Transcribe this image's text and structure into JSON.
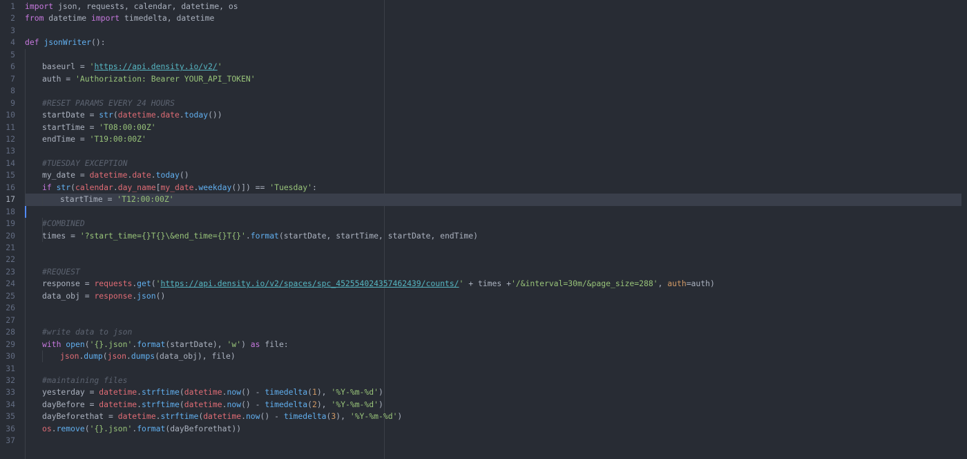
{
  "editor": {
    "active_line": 17,
    "colors": {
      "background": "#282c34",
      "keyword": "#c678dd",
      "function": "#61afef",
      "string": "#98c379",
      "number": "#d19a66",
      "module": "#e06c75",
      "comment": "#5c6370",
      "url": "#56b6c2",
      "text": "#abb2bf",
      "cursor": "#528bff"
    },
    "lines": [
      {
        "n": "1",
        "indent": 0,
        "tokens": [
          [
            "kw",
            "import"
          ],
          [
            "txt",
            " json, requests, calendar, datetime, os"
          ]
        ]
      },
      {
        "n": "2",
        "indent": 0,
        "tokens": [
          [
            "kw",
            "from"
          ],
          [
            "txt",
            " datetime "
          ],
          [
            "kw",
            "import"
          ],
          [
            "txt",
            " timedelta, datetime"
          ]
        ]
      },
      {
        "n": "3",
        "indent": 0,
        "tokens": []
      },
      {
        "n": "4",
        "indent": 0,
        "tokens": [
          [
            "kw",
            "def"
          ],
          [
            "txt",
            " "
          ],
          [
            "fn",
            "jsonWriter"
          ],
          [
            "txt",
            "():"
          ]
        ]
      },
      {
        "n": "5",
        "indent": 0,
        "tokens": []
      },
      {
        "n": "6",
        "indent": 1,
        "tokens": [
          [
            "txt",
            "baseurl = "
          ],
          [
            "str",
            "'"
          ],
          [
            "url",
            "https://api.density.io/v2/"
          ],
          [
            "str",
            "'"
          ]
        ]
      },
      {
        "n": "7",
        "indent": 1,
        "tokens": [
          [
            "txt",
            "auth = "
          ],
          [
            "str",
            "'Authorization: Bearer YOUR_API_TOKEN'"
          ]
        ]
      },
      {
        "n": "8",
        "indent": 0,
        "tokens": []
      },
      {
        "n": "9",
        "indent": 1,
        "tokens": [
          [
            "cm",
            "#RESET PARAMS EVERY 24 HOURS"
          ]
        ]
      },
      {
        "n": "10",
        "indent": 1,
        "tokens": [
          [
            "txt",
            "startDate = "
          ],
          [
            "fn",
            "str"
          ],
          [
            "txt",
            "("
          ],
          [
            "mod",
            "datetime"
          ],
          [
            "txt",
            "."
          ],
          [
            "mod",
            "date"
          ],
          [
            "txt",
            "."
          ],
          [
            "fn",
            "today"
          ],
          [
            "txt",
            "())"
          ]
        ]
      },
      {
        "n": "11",
        "indent": 1,
        "tokens": [
          [
            "txt",
            "startTime = "
          ],
          [
            "str",
            "'T08:00:00Z'"
          ]
        ]
      },
      {
        "n": "12",
        "indent": 1,
        "tokens": [
          [
            "txt",
            "endTime = "
          ],
          [
            "str",
            "'T19:00:00Z'"
          ]
        ]
      },
      {
        "n": "13",
        "indent": 0,
        "tokens": []
      },
      {
        "n": "14",
        "indent": 1,
        "tokens": [
          [
            "cm",
            "#TUESDAY EXCEPTION"
          ]
        ]
      },
      {
        "n": "15",
        "indent": 1,
        "tokens": [
          [
            "txt",
            "my_date = "
          ],
          [
            "mod",
            "datetime"
          ],
          [
            "txt",
            "."
          ],
          [
            "mod",
            "date"
          ],
          [
            "txt",
            "."
          ],
          [
            "fn",
            "today"
          ],
          [
            "txt",
            "()"
          ]
        ]
      },
      {
        "n": "16",
        "indent": 1,
        "tokens": [
          [
            "kw",
            "if"
          ],
          [
            "txt",
            " "
          ],
          [
            "fn",
            "str"
          ],
          [
            "txt",
            "("
          ],
          [
            "mod",
            "calendar"
          ],
          [
            "txt",
            "."
          ],
          [
            "mod",
            "day_name"
          ],
          [
            "txt",
            "["
          ],
          [
            "mod",
            "my_date"
          ],
          [
            "txt",
            "."
          ],
          [
            "fn",
            "weekday"
          ],
          [
            "txt",
            "()]) == "
          ],
          [
            "str",
            "'Tuesday'"
          ],
          [
            "txt",
            ":"
          ]
        ]
      },
      {
        "n": "17",
        "indent": 2,
        "tokens": [
          [
            "txt",
            "startTime = "
          ],
          [
            "str",
            "'T12:00:00Z'"
          ]
        ]
      },
      {
        "n": "18",
        "indent": 0,
        "tokens": []
      },
      {
        "n": "19",
        "indent": 1,
        "tokens": [
          [
            "cm",
            "#COMBINED"
          ]
        ]
      },
      {
        "n": "20",
        "indent": 1,
        "tokens": [
          [
            "txt",
            "times = "
          ],
          [
            "str",
            "'?start_time={}T{}\\&end_time={}T{}'"
          ],
          [
            "txt",
            "."
          ],
          [
            "fn",
            "format"
          ],
          [
            "txt",
            "(startDate, startTime, startDate, endTime)"
          ]
        ]
      },
      {
        "n": "21",
        "indent": 0,
        "tokens": []
      },
      {
        "n": "22",
        "indent": 0,
        "tokens": []
      },
      {
        "n": "23",
        "indent": 1,
        "tokens": [
          [
            "cm",
            "#REQUEST"
          ]
        ]
      },
      {
        "n": "24",
        "indent": 1,
        "tokens": [
          [
            "txt",
            "response = "
          ],
          [
            "mod",
            "requests"
          ],
          [
            "txt",
            "."
          ],
          [
            "fn",
            "get"
          ],
          [
            "txt",
            "("
          ],
          [
            "str",
            "'"
          ],
          [
            "url",
            "https://api.density.io/v2/spaces/spc_452554024357462439/counts/"
          ],
          [
            "str",
            "'"
          ],
          [
            "txt",
            " + times +"
          ],
          [
            "str",
            "'/&interval=30m/&page_size=288'"
          ],
          [
            "txt",
            ", "
          ],
          [
            "num",
            "auth"
          ],
          [
            "txt",
            "=auth)"
          ]
        ]
      },
      {
        "n": "25",
        "indent": 1,
        "tokens": [
          [
            "txt",
            "data_obj = "
          ],
          [
            "mod",
            "response"
          ],
          [
            "txt",
            "."
          ],
          [
            "fn",
            "json"
          ],
          [
            "txt",
            "()"
          ]
        ]
      },
      {
        "n": "26",
        "indent": 0,
        "tokens": []
      },
      {
        "n": "27",
        "indent": 0,
        "tokens": []
      },
      {
        "n": "28",
        "indent": 1,
        "tokens": [
          [
            "cm",
            "#write data to json"
          ]
        ]
      },
      {
        "n": "29",
        "indent": 1,
        "tokens": [
          [
            "kw",
            "with"
          ],
          [
            "txt",
            " "
          ],
          [
            "fn",
            "open"
          ],
          [
            "txt",
            "("
          ],
          [
            "str",
            "'{}.json'"
          ],
          [
            "txt",
            "."
          ],
          [
            "fn",
            "format"
          ],
          [
            "txt",
            "(startDate), "
          ],
          [
            "str",
            "'w'"
          ],
          [
            "txt",
            ") "
          ],
          [
            "kw",
            "as"
          ],
          [
            "txt",
            " file:"
          ]
        ]
      },
      {
        "n": "30",
        "indent": 2,
        "tokens": [
          [
            "mod",
            "json"
          ],
          [
            "txt",
            "."
          ],
          [
            "fn",
            "dump"
          ],
          [
            "txt",
            "("
          ],
          [
            "mod",
            "json"
          ],
          [
            "txt",
            "."
          ],
          [
            "fn",
            "dumps"
          ],
          [
            "txt",
            "(data_obj), file)"
          ]
        ]
      },
      {
        "n": "31",
        "indent": 0,
        "tokens": []
      },
      {
        "n": "32",
        "indent": 1,
        "tokens": [
          [
            "cm",
            "#maintaining files"
          ]
        ]
      },
      {
        "n": "33",
        "indent": 1,
        "tokens": [
          [
            "txt",
            "yesterday = "
          ],
          [
            "mod",
            "datetime"
          ],
          [
            "txt",
            "."
          ],
          [
            "fn",
            "strftime"
          ],
          [
            "txt",
            "("
          ],
          [
            "mod",
            "datetime"
          ],
          [
            "txt",
            "."
          ],
          [
            "fn",
            "now"
          ],
          [
            "txt",
            "() - "
          ],
          [
            "fn",
            "timedelta"
          ],
          [
            "txt",
            "("
          ],
          [
            "num",
            "1"
          ],
          [
            "txt",
            "), "
          ],
          [
            "str",
            "'%Y-%m-%d'"
          ],
          [
            "txt",
            ")"
          ]
        ]
      },
      {
        "n": "34",
        "indent": 1,
        "tokens": [
          [
            "txt",
            "dayBefore = "
          ],
          [
            "mod",
            "datetime"
          ],
          [
            "txt",
            "."
          ],
          [
            "fn",
            "strftime"
          ],
          [
            "txt",
            "("
          ],
          [
            "mod",
            "datetime"
          ],
          [
            "txt",
            "."
          ],
          [
            "fn",
            "now"
          ],
          [
            "txt",
            "() - "
          ],
          [
            "fn",
            "timedelta"
          ],
          [
            "txt",
            "("
          ],
          [
            "num",
            "2"
          ],
          [
            "txt",
            "), "
          ],
          [
            "str",
            "'%Y-%m-%d'"
          ],
          [
            "txt",
            ")"
          ]
        ]
      },
      {
        "n": "35",
        "indent": 1,
        "tokens": [
          [
            "txt",
            "dayBeforethat = "
          ],
          [
            "mod",
            "datetime"
          ],
          [
            "txt",
            "."
          ],
          [
            "fn",
            "strftime"
          ],
          [
            "txt",
            "("
          ],
          [
            "mod",
            "datetime"
          ],
          [
            "txt",
            "."
          ],
          [
            "fn",
            "now"
          ],
          [
            "txt",
            "() - "
          ],
          [
            "fn",
            "timedelta"
          ],
          [
            "txt",
            "("
          ],
          [
            "num",
            "3"
          ],
          [
            "txt",
            "), "
          ],
          [
            "str",
            "'%Y-%m-%d'"
          ],
          [
            "txt",
            ")"
          ]
        ]
      },
      {
        "n": "36",
        "indent": 1,
        "tokens": [
          [
            "mod",
            "os"
          ],
          [
            "txt",
            "."
          ],
          [
            "fn",
            "remove"
          ],
          [
            "txt",
            "("
          ],
          [
            "str",
            "'{}.json'"
          ],
          [
            "txt",
            "."
          ],
          [
            "fn",
            "format"
          ],
          [
            "txt",
            "(dayBeforethat))"
          ]
        ]
      },
      {
        "n": "37",
        "indent": 0,
        "tokens": []
      }
    ]
  }
}
